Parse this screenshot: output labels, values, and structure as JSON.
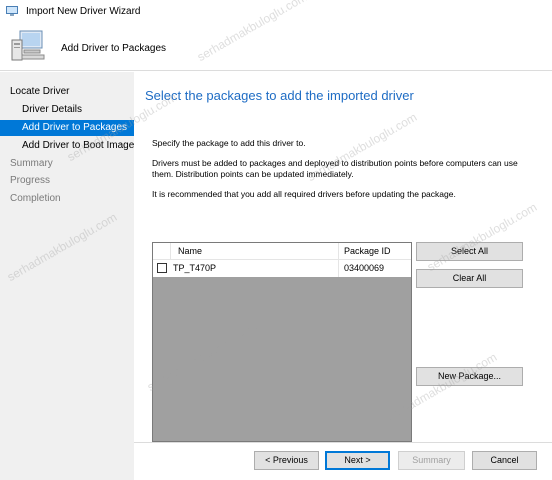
{
  "window": {
    "title": "Import New Driver Wizard"
  },
  "header": {
    "heading": "Add Driver to Packages"
  },
  "nav": {
    "items": [
      {
        "label": "Locate Driver"
      },
      {
        "label": "Driver Details"
      },
      {
        "label": "Add Driver to Packages"
      },
      {
        "label": "Add Driver to Boot Images"
      },
      {
        "label": "Summary"
      },
      {
        "label": "Progress"
      },
      {
        "label": "Completion"
      }
    ]
  },
  "main": {
    "page_title": "Select the packages to add the imported driver",
    "instruction": "Specify the package to add this driver to.",
    "paragraph1_line1": "Drivers must be added to packages and deployed to distribution points before computers can use",
    "paragraph1_line2": "them.  Distribution points can be updated immediately.",
    "paragraph2": "It is recommended that you add all required drivers before updating the package."
  },
  "packages_table": {
    "columns": [
      "Name",
      "Package ID"
    ],
    "rows": [
      {
        "name": "TP_T470P",
        "package_id": "03400069",
        "checked": false
      }
    ]
  },
  "side_buttons": {
    "select_all": "Select All",
    "clear_all": "Clear All",
    "new_package": "New Package..."
  },
  "footer": {
    "previous": "< Previous",
    "next": "Next >",
    "summary": "Summary",
    "cancel": "Cancel"
  },
  "watermark": "serhadmakbuloglu.com",
  "colors": {
    "accent": "#0078d7",
    "title_blue": "#1e6cc4",
    "nav_bg": "#f0f0f0",
    "list_bg": "#a0a0a0"
  },
  "icons": {
    "title": "wizard-app-icon",
    "header": "computer-icon"
  }
}
